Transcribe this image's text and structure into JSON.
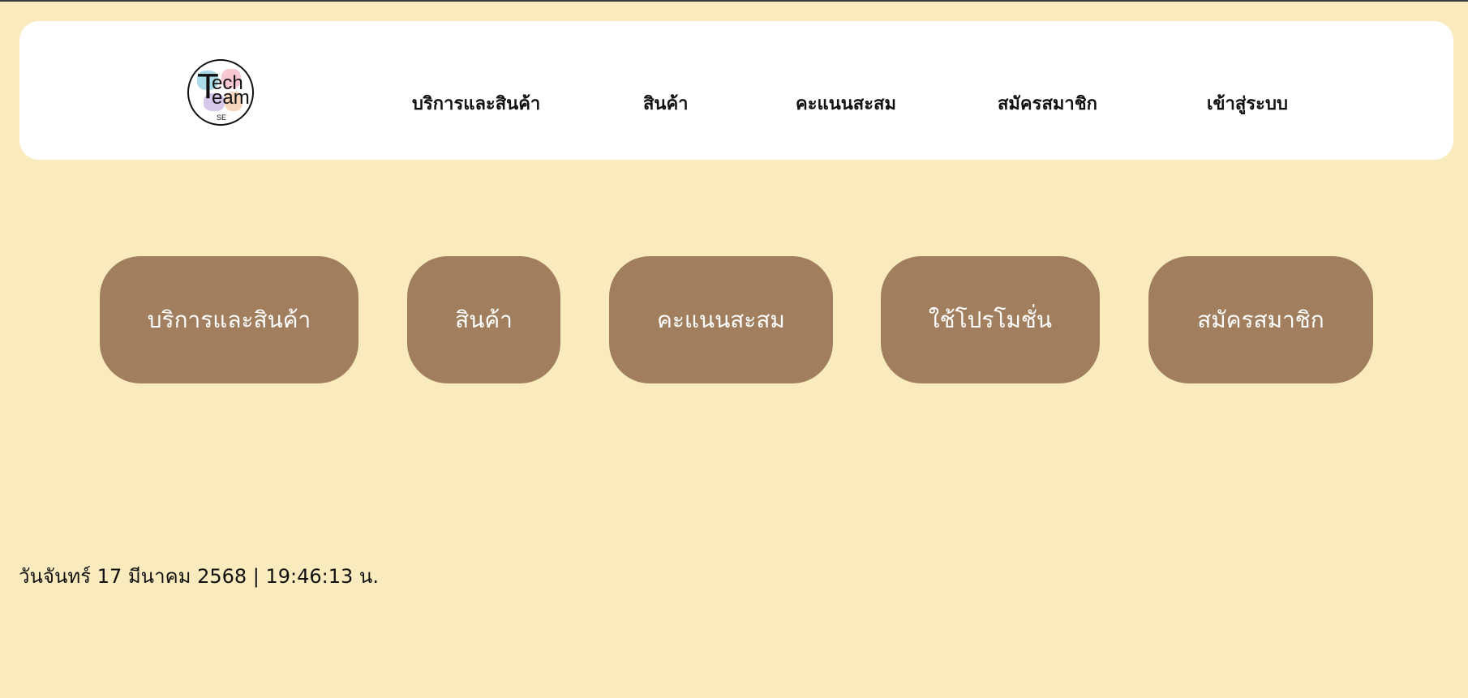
{
  "colors": {
    "page_background": "#faebbe",
    "navbar_background": "#ffffff",
    "button_background": "#a17f5e",
    "button_text": "#ffffff",
    "text": "#111111"
  },
  "logo": {
    "icon": "tech-team-logo-icon",
    "text_line1": "Tech",
    "text_line2": "Team",
    "text_sub": "SE"
  },
  "nav": {
    "services": "บริการและสินค้า",
    "products": "สินค้า",
    "points": "คะแนนสะสม",
    "register": "สมัครสมาชิก",
    "login": "เข้าสู่ระบบ"
  },
  "buttons": {
    "services": "บริการและสินค้า",
    "products": "สินค้า",
    "points": "คะแนนสะสม",
    "promotion": "ใช้โปรโมชั่น",
    "register": "สมัครสมาชิก"
  },
  "datetime": "วันจันทร์ 17 มีนาคม 2568 | 19:46:13 น."
}
